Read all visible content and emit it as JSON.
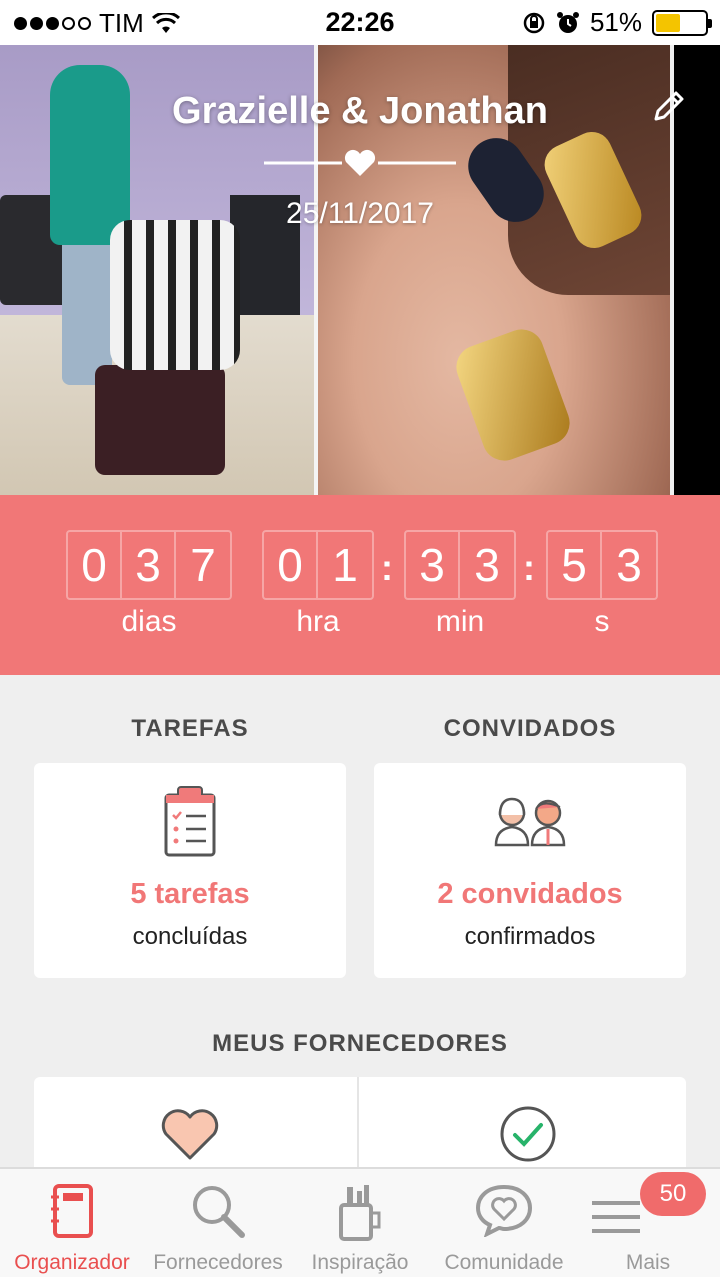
{
  "status_bar": {
    "carrier": "TIM",
    "time": "22:26",
    "battery": "51%",
    "battery_level": 0.51
  },
  "header": {
    "couple_names": "Grazielle & Jonathan",
    "wedding_date": "25/11/2017",
    "edit_icon": "pencil-icon"
  },
  "countdown": {
    "days": [
      "0",
      "3",
      "7"
    ],
    "hours": [
      "0",
      "1"
    ],
    "minutes": [
      "3",
      "3"
    ],
    "seconds": [
      "5",
      "3"
    ],
    "labels": {
      "days": "dias",
      "hours": "hra",
      "minutes": "min",
      "seconds": "s"
    },
    "separator": ":"
  },
  "tasks": {
    "title": "TAREFAS",
    "count_text": "5 tarefas",
    "sub_text": "concluídas",
    "icon": "clipboard-checklist-icon"
  },
  "guests": {
    "title": "CONVIDADOS",
    "count_text": "2 convidados",
    "sub_text": "confirmados",
    "icon": "couple-icon"
  },
  "vendors": {
    "title": "MEUS FORNECEDORES",
    "left_icon": "heart-icon",
    "right_icon": "check-circle-icon"
  },
  "tabbar": {
    "items": [
      {
        "label": "Organizador",
        "icon": "notebook-icon",
        "active": true
      },
      {
        "label": "Fornecedores",
        "icon": "search-icon",
        "active": false
      },
      {
        "label": "Inspiração",
        "icon": "cup-tools-icon",
        "active": false
      },
      {
        "label": "Comunidade",
        "icon": "chat-heart-icon",
        "active": false
      },
      {
        "label": "Mais",
        "icon": "menu-icon",
        "active": false
      }
    ],
    "badge": "50"
  },
  "colors": {
    "accent": "#f17777",
    "active_tab": "#e94f4f",
    "background": "#efefef"
  }
}
